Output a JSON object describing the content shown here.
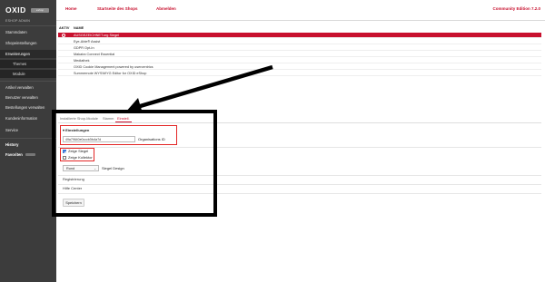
{
  "sidebar": {
    "logo_text": "OXID",
    "logo_sub": "eshop",
    "subtitle": "ESHOP ADMIN",
    "items": [
      {
        "label": "Stammdaten"
      },
      {
        "label": "Shopeinstellungen"
      },
      {
        "label": "Erweiterungen"
      },
      {
        "label": "Themes"
      },
      {
        "label": "Module"
      },
      {
        "label": "Artikel verwalten"
      },
      {
        "label": "Benutzer verwalten"
      },
      {
        "label": "Bestellungen verwalten"
      },
      {
        "label": "Kundeninformation"
      },
      {
        "label": "Service"
      },
      {
        "label": "History"
      },
      {
        "label": "Favoriten"
      }
    ]
  },
  "topbar": {
    "home": "Home",
    "shop_start": "Startseite des Shops",
    "logout": "Abmelden",
    "edition": "Community Edition 7.2.0"
  },
  "module_list": {
    "col_active": "AKTIV",
    "col_name": "NAME",
    "rows": [
      {
        "name": "AUSGEZEICHNET.org Siegel",
        "selected": true
      },
      {
        "name": "Eye-Able® Assist",
        "selected": false
      },
      {
        "name": "GDPR Opt-In",
        "selected": false
      },
      {
        "name": "Makaira Connect Essential",
        "selected": false
      },
      {
        "name": "Mediathek",
        "selected": false
      },
      {
        "name": "OXID Cookie Management powered by usercentrics",
        "selected": false
      },
      {
        "name": "Summernote WYSIWYG Editor for OXID eShop",
        "selected": false
      }
    ]
  },
  "tabs": [
    {
      "label": "Installierte Shop-Module",
      "active": false
    },
    {
      "label": "Stamm",
      "active": false
    },
    {
      "label": "Einstell.",
      "active": true
    }
  ],
  "settings": {
    "group_title": "▾ Einstellungen",
    "org_id_value": "49a79640e0cccb3fc4a7d",
    "org_id_label": "Organisations ID",
    "show_seal": {
      "label": "Zeige Siegel",
      "checked": true
    },
    "show_collector": {
      "label": "Zeige Kollektor",
      "checked": false
    },
    "seal_design_value": "Rund",
    "seal_design_label": "Siegel Design",
    "registration": "Registrierung",
    "help_center": "Hilfe Center",
    "save": "Speichern"
  },
  "colors": {
    "accent": "#c8102e",
    "sidebar_bg": "#3c3c3c",
    "highlight": "#e32525"
  }
}
